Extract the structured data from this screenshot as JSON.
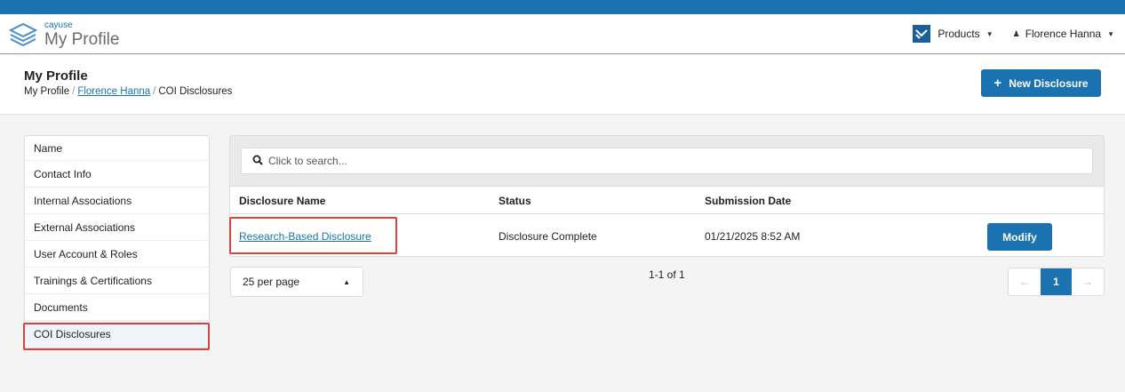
{
  "header": {
    "brand": "cayuse",
    "app_title": "My Profile",
    "products_label": "Products",
    "user_label": "Florence Hanna"
  },
  "page": {
    "title": "My Profile",
    "breadcrumb": [
      "My Profile",
      "Florence Hanna",
      "COI Disclosures"
    ],
    "breadcrumb_sep": "/",
    "new_button_label": "New Disclosure"
  },
  "sidebar": {
    "items": [
      {
        "label": "Name"
      },
      {
        "label": "Contact Info"
      },
      {
        "label": "Internal Associations"
      },
      {
        "label": "External Associations"
      },
      {
        "label": "User Account & Roles"
      },
      {
        "label": "Trainings & Certifications"
      },
      {
        "label": "Documents"
      },
      {
        "label": "COI Disclosures",
        "active": true
      }
    ]
  },
  "search": {
    "placeholder": "Click to search..."
  },
  "table": {
    "columns": [
      "Disclosure Name",
      "Status",
      "Submission Date"
    ],
    "rows": [
      {
        "name": "Research-Based Disclosure",
        "status": "Disclosure Complete",
        "date": "01/21/2025 8:52 AM",
        "action": "Modify"
      }
    ]
  },
  "pagination": {
    "per_page": "25 per page",
    "range": "1-1 of 1",
    "current_page": "1",
    "prev_icon": "←",
    "next_icon": "→"
  },
  "colors": {
    "accent": "#1a73b0",
    "highlight": "#d6453d"
  }
}
